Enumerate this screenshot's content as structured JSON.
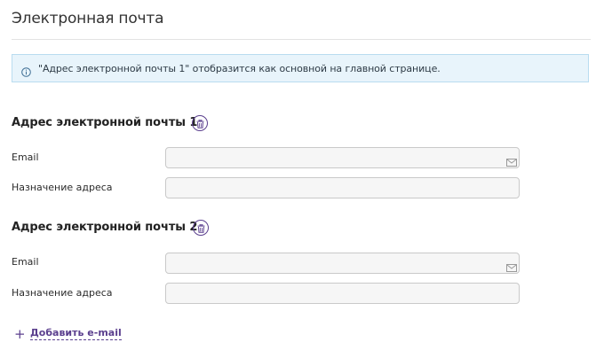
{
  "page": {
    "title": "Электронная почта"
  },
  "info": {
    "text": "\"Адрес электронной почты 1\" отобразится как основной на главной странице.",
    "icon": "info-icon",
    "colors": {
      "background": "#e8f4fb",
      "border": "#b9dcf0"
    }
  },
  "emails": [
    {
      "heading": "Адрес электронной почты 1",
      "email_label": "Email",
      "email_value": "",
      "purpose_label": "Назначение адреса",
      "purpose_value": "",
      "delete_icon": "trash-icon"
    },
    {
      "heading": "Адрес электронной почты 2",
      "email_label": "Email",
      "email_value": "",
      "purpose_label": "Назначение адреса",
      "purpose_value": "",
      "delete_icon": "trash-icon"
    }
  ],
  "add": {
    "label": "Добавить e-mail",
    "icon": "plus-icon"
  },
  "colors": {
    "accent": "#5b3f8e",
    "input_background": "#f6f6f6",
    "input_border": "#c9c9c9"
  }
}
